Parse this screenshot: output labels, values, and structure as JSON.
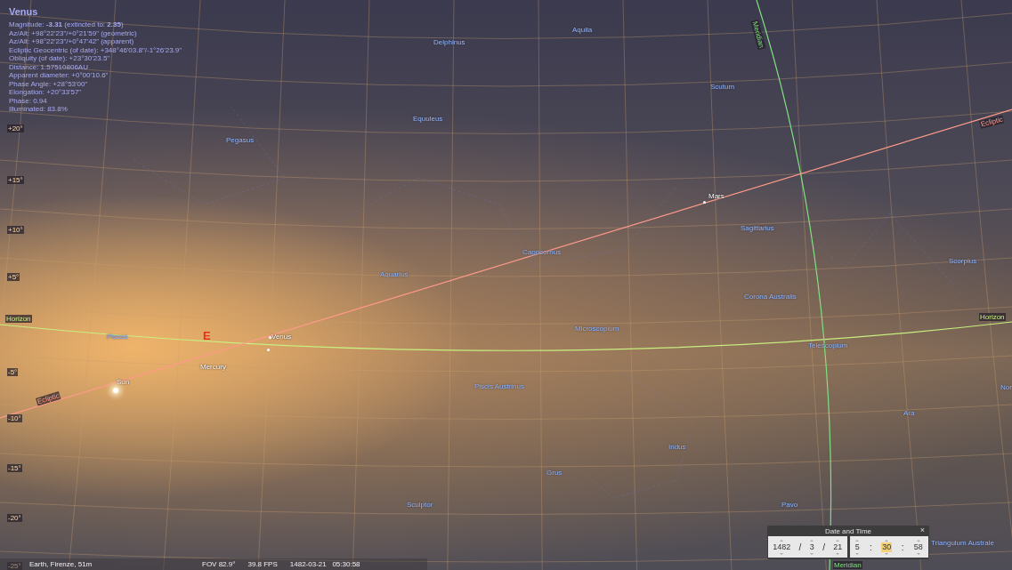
{
  "object_info": {
    "name": "Venus",
    "lines": [
      "Magnitude: **-3.31** (extincted to: **2.35**)",
      "Az/Alt: +98°22'23\"/+0°21'59\" (geometric)",
      "Az/Alt: +98°22'23\"/+0°47'42\" (apparent)",
      "Ecliptic Geocentric (of date): +348°46'03.8\"/-1°26'23.9\"",
      "Obliquity (of date): +23°30'23.5\"",
      "Distance: 1.57510806AU",
      "Apparent diameter: +0°00'10.6\"",
      "Phase Angle: +28°53'00\"",
      "Elongation: +20°33'57\"",
      "Phase: 0.94",
      "Illuminated: 83.8%"
    ]
  },
  "constellations": [
    "Delphinus",
    "Aquila",
    "Scutum",
    "Equuleus",
    "Pegasus",
    "Sagittarius",
    "Scorpius",
    "Capricornus",
    "Aquarius",
    "Corona Australis",
    "Pisces",
    "Microscopium",
    "Telescopium",
    "Piscis Austrinus",
    "Nor",
    "Ara",
    "Indus",
    "Grus",
    "Sculptor",
    "Pavo",
    "Triangulum Australe"
  ],
  "planets": [
    "Mars",
    "Venus",
    "Mercury",
    "Sun"
  ],
  "cardinal_point": "E",
  "sky_lines": [
    {
      "kind": "horizon",
      "labels": [
        "Horizon",
        "Horizon"
      ]
    },
    {
      "kind": "ecliptic",
      "labels": [
        "Ecliptic",
        "Ecliptic"
      ]
    },
    {
      "kind": "meridian",
      "labels": [
        "Meridian",
        "Meridian"
      ]
    }
  ],
  "altitude_labels": [
    "+20°",
    "+15°",
    "+10°",
    "+5°",
    "-5°",
    "-10°",
    "-15°",
    "-20°",
    "-25°"
  ],
  "status_bar": {
    "location": "Earth, Firenze, 51m",
    "fov": "FOV 82.9°",
    "fps": "39.8 FPS",
    "datetime": "1482-03-21   05:30:58"
  },
  "date_time_dialog": {
    "title": "Date and Time",
    "close": "×",
    "date_parts": [
      {
        "kind": "field",
        "text": "1482",
        "selected": false
      },
      {
        "kind": "separator",
        "text": "/"
      },
      {
        "kind": "field",
        "text": "3",
        "selected": false
      },
      {
        "kind": "separator",
        "text": "/"
      },
      {
        "kind": "field",
        "text": "21",
        "selected": false
      }
    ],
    "time_parts": [
      {
        "kind": "field",
        "text": "5",
        "selected": false
      },
      {
        "kind": "separator",
        "text": ":"
      },
      {
        "kind": "field",
        "text": "30",
        "selected": true
      },
      {
        "kind": "separator",
        "text": ":"
      },
      {
        "kind": "field",
        "text": "58",
        "selected": false
      }
    ]
  }
}
